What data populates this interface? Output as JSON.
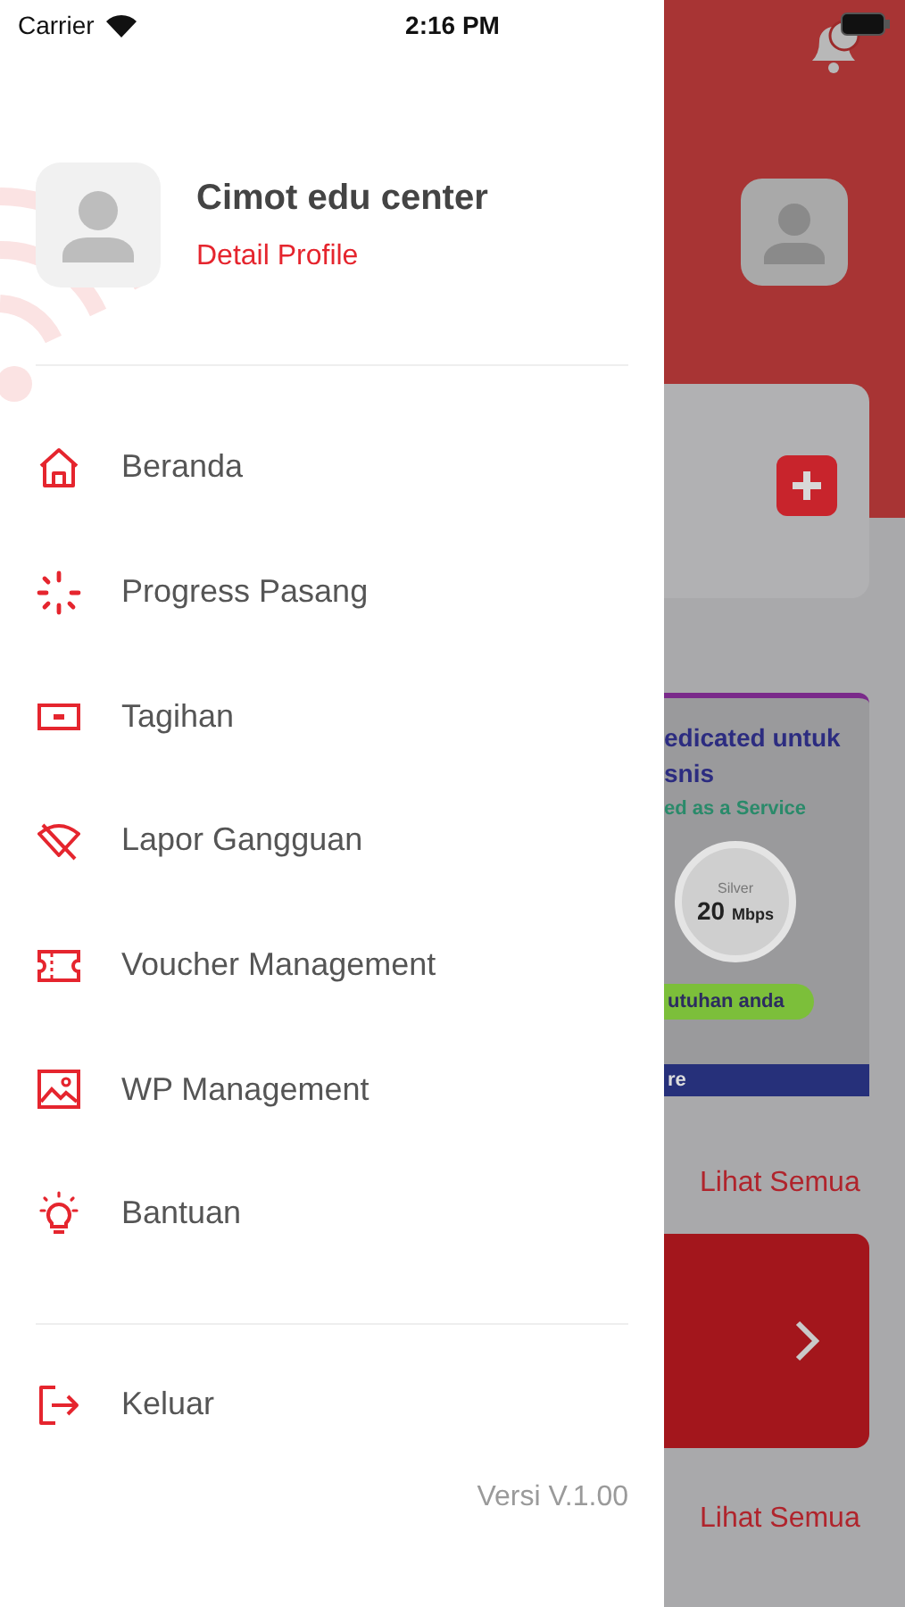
{
  "status_bar": {
    "carrier": "Carrier",
    "time": "2:16 PM"
  },
  "profile": {
    "name": "Cimot edu center",
    "link": "Detail Profile"
  },
  "menu": [
    {
      "label": "Beranda"
    },
    {
      "label": "Progress Pasang"
    },
    {
      "label": "Tagihan"
    },
    {
      "label": "Lapor Gangguan"
    },
    {
      "label": "Voucher Management"
    },
    {
      "label": "WP Management"
    },
    {
      "label": "Bantuan"
    }
  ],
  "logout": {
    "label": "Keluar"
  },
  "version": "Versi V.1.00",
  "background": {
    "banner": {
      "title_lines": [
        "edicated untuk",
        "snis"
      ],
      "subtitle": "ed as a Service",
      "tier": "Silver",
      "speed": "20",
      "unit": "Mbps",
      "pill": "utuhan anda",
      "footer": "re"
    },
    "see_all": [
      "Lihat Semua",
      "Lihat Semua"
    ]
  }
}
